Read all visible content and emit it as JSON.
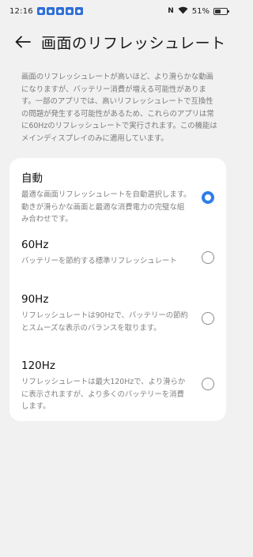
{
  "status_bar": {
    "time": "12:16",
    "notification_icons": [
      "app-notification-icon",
      "app-notification-icon",
      "app-notification-icon",
      "app-notification-icon",
      "app-notification-icon"
    ],
    "nfc_label": "N",
    "battery_percent": "51%",
    "battery_level": 0.51
  },
  "header": {
    "back_icon": "arrow-left-icon",
    "title": "画面のリフレッシュレート"
  },
  "description": "画面のリフレッシュレートが高いほど、より滑らかな動画になりますが、バッテリー消費が増える可能性があります。一部のアプリでは、高いリフレッシュレートで互換性の問題が発生する可能性があるため、これらのアプリは常に60Hzのリフレッシュレートで実行されます。この機能はメインディスプレイのみに適用しています。",
  "options": [
    {
      "title": "自動",
      "description": "最適な画面リフレッシュレートを自動選択します。動きが滑らかな画面と最適な消費電力の完璧な組み合わせです。",
      "selected": true
    },
    {
      "title": "60Hz",
      "description": "バッテリーを節約する標準リフレッシュレート",
      "selected": false
    },
    {
      "title": "90Hz",
      "description": "リフレッシュレートは90Hzで、バッテリーの節約とスムーズな表示のバランスを取ります。",
      "selected": false
    },
    {
      "title": "120Hz",
      "description": "リフレッシュレートは最大120Hzで、より滑らかに表示されますが、より多くのバッテリーを消費します。",
      "selected": false
    }
  ],
  "colors": {
    "accent": "#2e7de9",
    "background": "#f1f1f1",
    "card": "#ffffff",
    "secondary_text": "#808080"
  }
}
